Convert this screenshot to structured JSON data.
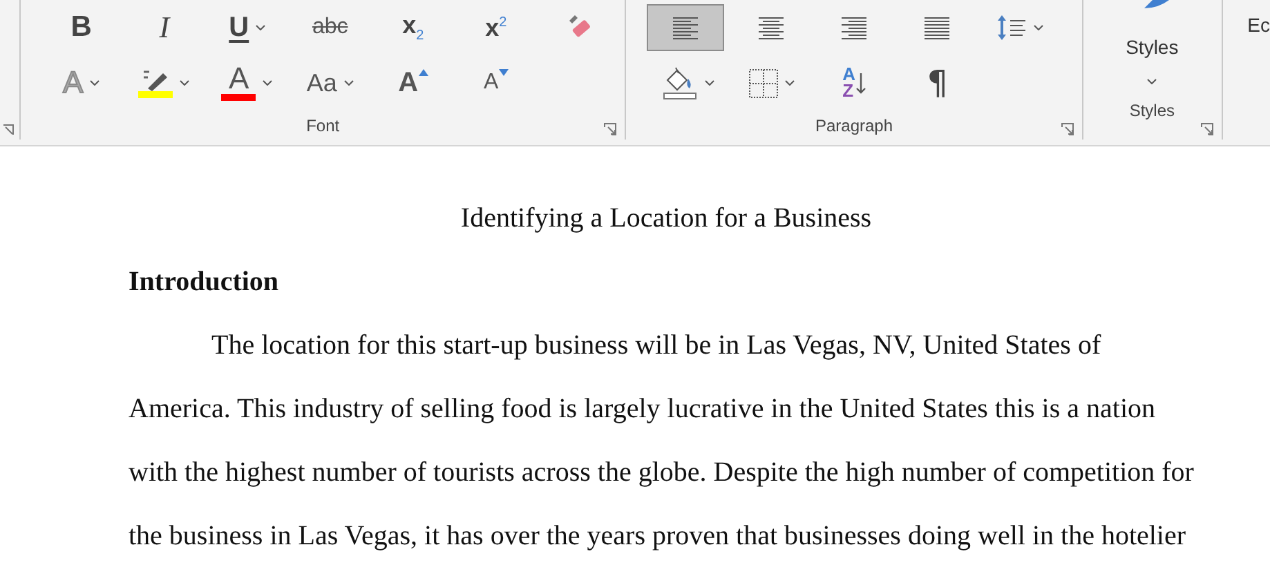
{
  "ribbon": {
    "groups": [
      {
        "label": "Font",
        "launcher": true,
        "rows": [
          [
            {
              "kind": "bold",
              "glyph": "B"
            },
            {
              "kind": "italic",
              "glyph": "I"
            },
            {
              "kind": "underline",
              "glyph": "U",
              "dropdown": true
            },
            {
              "kind": "strike",
              "glyph": "abc"
            },
            {
              "kind": "subscript",
              "glyph": "x$_{2}$"
            },
            {
              "kind": "superscript",
              "glyph": "x$^{2}$"
            },
            {
              "kind": "eraser"
            }
          ],
          [
            {
              "kind": "effects",
              "glyph": "A",
              "dropdown": true
            },
            {
              "kind": "highlight",
              "dropdown": true,
              "color": "#ffff00"
            },
            {
              "kind": "fontcolor",
              "glyph": "A",
              "dropdown": true,
              "color": "#ff0000"
            },
            {
              "kind": "case",
              "glyph": "Aa",
              "dropdown": true
            },
            {
              "kind": "grow",
              "glyph": "A"
            },
            {
              "kind": "shrink",
              "glyph": "A"
            }
          ]
        ]
      },
      {
        "label": "Paragraph",
        "launcher": true,
        "rows": [
          [
            {
              "kind": "align-left",
              "selected": true
            },
            {
              "kind": "align-center",
              "selected": false
            },
            {
              "kind": "align-right",
              "selected": false
            },
            {
              "kind": "justify",
              "selected": false
            },
            {
              "kind": "line-spacing",
              "dropdown": true
            }
          ],
          [
            {
              "kind": "shading",
              "dropdown": true
            },
            {
              "kind": "borders",
              "dropdown": true
            },
            {
              "kind": "sort",
              "glyph_top": "A",
              "glyph_bottom": "Z"
            },
            {
              "kind": "pilcrow",
              "glyph": "¶"
            }
          ]
        ]
      },
      {
        "label": "Styles",
        "launcher": true,
        "big": {
          "label": "Styles",
          "dropdown": true
        }
      },
      {
        "partial_label": "Ec"
      }
    ]
  },
  "document": {
    "title": "Identifying a Location for a Business",
    "heading": "Introduction",
    "paragraph": "The location for this start-up business will be in Las Vegas, NV, United States of America. This industry of selling food is largely lucrative in the United States this is a nation with the highest number of tourists across the globe. Despite the high number of competition for the business in Las Vegas, it has over the years proven that businesses doing well in the hotelier"
  }
}
